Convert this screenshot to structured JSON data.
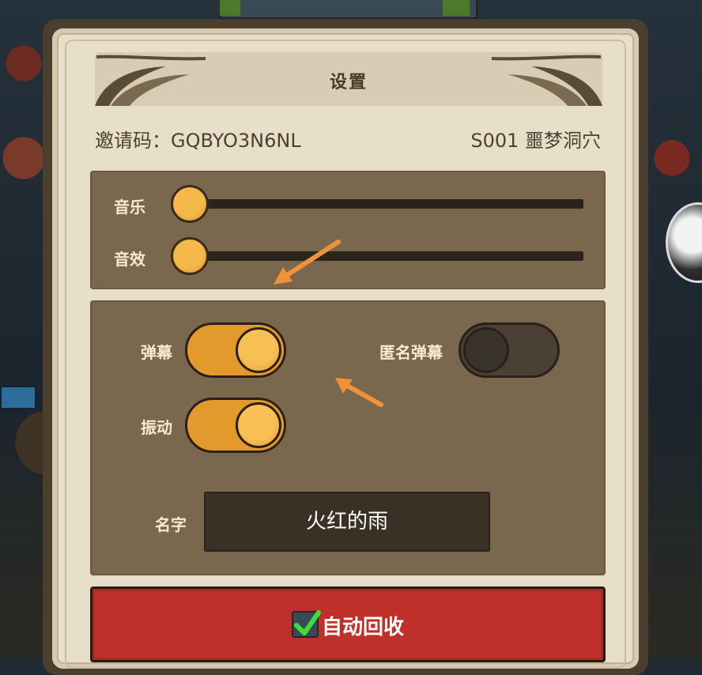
{
  "background": {
    "top_tab_text": "",
    "colors": {
      "backdrop": "#1f2a33",
      "panel": "#79684e",
      "dialog": "#e8dfc8",
      "button_red": "#c0302a",
      "accent_orange": "#e39a2c"
    }
  },
  "dialog": {
    "title": "设置",
    "invite_code": "邀请码：GQBYO3N6NL",
    "server": "S001 噩梦洞穴"
  },
  "audio": {
    "music_label": "音乐",
    "music_level": 0,
    "sfx_label": "音效",
    "sfx_level": 0
  },
  "toggles": {
    "danmaku_label": "弹幕",
    "danmaku_on": true,
    "anonymous_danmaku_label": "匿名弹幕",
    "anonymous_danmaku_on": false,
    "vibration_label": "振动",
    "vibration_on": true
  },
  "name": {
    "label": "名字",
    "value": "火红的雨"
  },
  "auto_recycle": {
    "label": "自动回收",
    "checked": true,
    "check_icon": "checkmark-icon"
  },
  "annotations": {
    "arrow_color": "#f0923a",
    "arrow_icon": "arrow-pointer-icon"
  }
}
